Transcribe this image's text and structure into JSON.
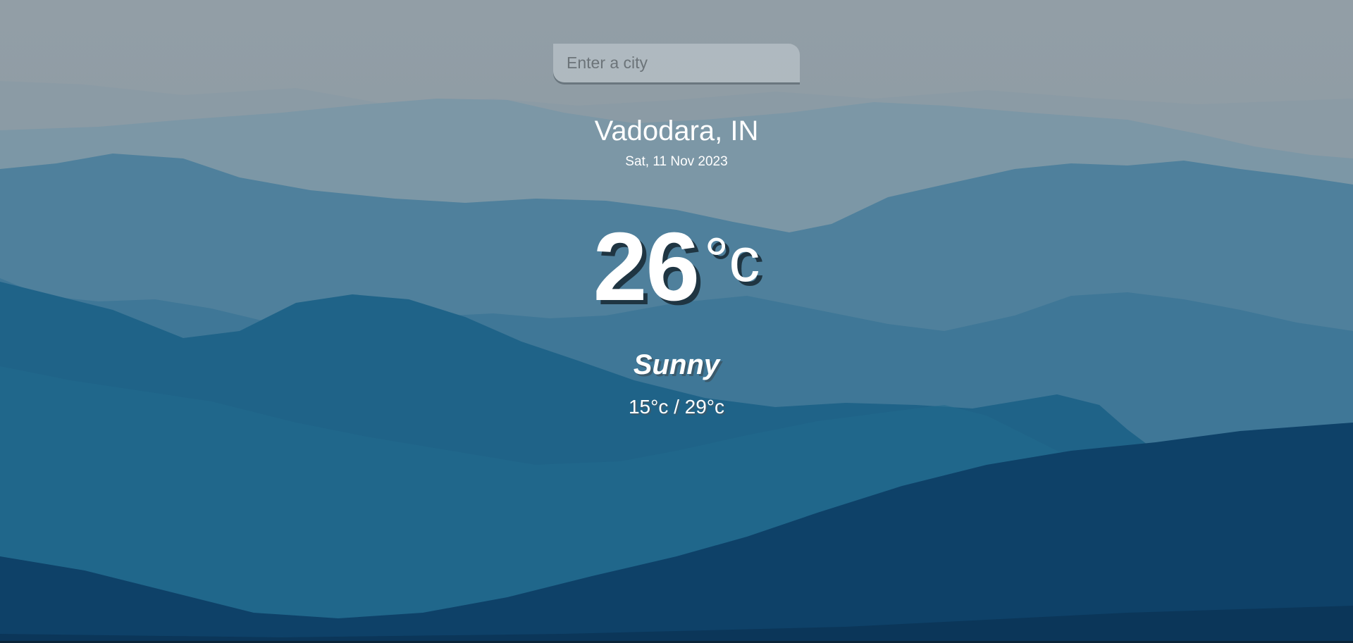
{
  "search": {
    "placeholder": "Enter a city",
    "value": ""
  },
  "location": {
    "name": "Vadodara, IN",
    "date": "Sat, 11 Nov 2023"
  },
  "weather": {
    "temperature": "26",
    "unit": "°c",
    "condition": "Sunny",
    "range": "15°c / 29°c"
  },
  "colors": {
    "sky": "#8e9aa2",
    "text": "#ffffff",
    "temp_shadow": "#1f3542",
    "mountain_far": "#7a97a6",
    "mountain_mid": "#3f7b9a",
    "mountain_near": "#1d6389",
    "mountain_front": "#0b3a60"
  }
}
